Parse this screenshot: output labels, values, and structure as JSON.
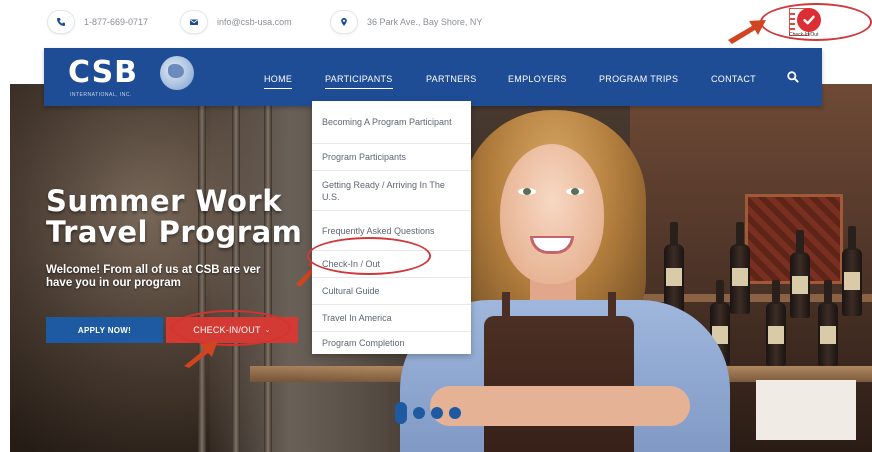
{
  "contact": {
    "phone": "1-877-669-0717",
    "email": "info@csb-usa.com",
    "address": "36 Park Ave., Bay Shore, NY"
  },
  "badge": {
    "text": "Check-In/Out"
  },
  "logo": {
    "text": "CSB",
    "sub": "INTERNATIONAL, INC."
  },
  "nav": {
    "items": [
      "HOME",
      "PARTICIPANTS",
      "PARTNERS",
      "EMPLOYERS",
      "PROGRAM TRIPS",
      "CONTACT"
    ],
    "active": "HOME"
  },
  "dropdown": {
    "items": [
      "Becoming A Program Participant",
      "Program Participants",
      "Getting Ready / Arriving In The U.S.",
      "Frequently Asked Questions",
      "Check-In / Out",
      "Cultural Guide",
      "Travel In America",
      "Program Completion"
    ]
  },
  "hero": {
    "title_line1": "Summer Work",
    "title_line2": "Travel Program",
    "welcome_line1": "Welcome! From all of us at CSB are ver",
    "welcome_line2": "have you in our program",
    "apply_label": "APPLY NOW!",
    "checkin_label": "CHECK-IN/OUT"
  },
  "colors": {
    "nav_bg": "#1f4d95",
    "accent_blue": "#1e5aa2",
    "accent_red": "#d33a34",
    "annotation_red": "#d0393b"
  },
  "icons": [
    "phone-icon",
    "envelope-icon",
    "map-marker-icon",
    "search-icon",
    "chevron-down-icon",
    "check-icon",
    "arrow-icon"
  ]
}
